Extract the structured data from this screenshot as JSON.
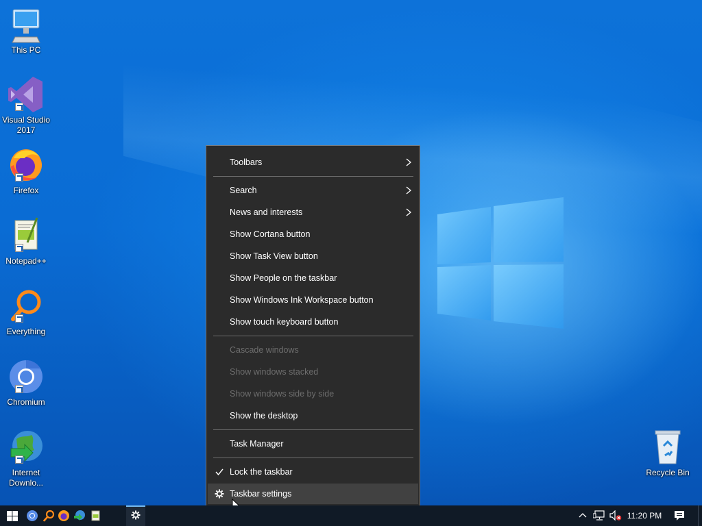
{
  "desktop": {
    "icons": [
      {
        "label": "This PC",
        "icon": "computer-icon"
      },
      {
        "label": "Visual Studio 2017",
        "icon": "visual-studio-icon"
      },
      {
        "label": "Firefox",
        "icon": "firefox-icon"
      },
      {
        "label": "Notepad++",
        "icon": "notepad-plus-plus-icon"
      },
      {
        "label": "Everything",
        "icon": "search-magnifier-icon"
      },
      {
        "label": "Chromium",
        "icon": "chromium-icon"
      },
      {
        "label": "Internet Downlo...",
        "icon": "internet-download-manager-icon"
      }
    ],
    "recycle_bin": {
      "label": "Recycle Bin",
      "icon": "recycle-bin-icon"
    }
  },
  "context_menu": {
    "items": [
      {
        "label": "Toolbars",
        "submenu": true,
        "enabled": true
      },
      {
        "label": "Search",
        "submenu": true,
        "enabled": true
      },
      {
        "label": "News and interests",
        "submenu": true,
        "enabled": true
      },
      {
        "label": "Show Cortana button",
        "enabled": true
      },
      {
        "label": "Show Task View button",
        "enabled": true
      },
      {
        "label": "Show People on the taskbar",
        "enabled": true
      },
      {
        "label": "Show Windows Ink Workspace button",
        "enabled": true
      },
      {
        "label": "Show touch keyboard button",
        "enabled": true
      },
      {
        "label": "Cascade windows",
        "enabled": false
      },
      {
        "label": "Show windows stacked",
        "enabled": false
      },
      {
        "label": "Show windows side by side",
        "enabled": false
      },
      {
        "label": "Show the desktop",
        "enabled": true
      },
      {
        "label": "Task Manager",
        "enabled": true
      },
      {
        "label": "Lock the taskbar",
        "enabled": true,
        "checked": true
      },
      {
        "label": "Taskbar settings",
        "enabled": true,
        "icon": "gear-icon",
        "hovered": true
      }
    ]
  },
  "taskbar": {
    "pinned": [
      "start-icon",
      "chromium-icon",
      "everything-icon",
      "firefox-icon",
      "internet-download-manager-icon",
      "notepad-plus-plus-icon",
      "settings-gear-icon"
    ],
    "tray": {
      "time": "11:20 PM"
    },
    "colors": {
      "background": "#101a26",
      "active_underline": "#76b9ed"
    }
  }
}
